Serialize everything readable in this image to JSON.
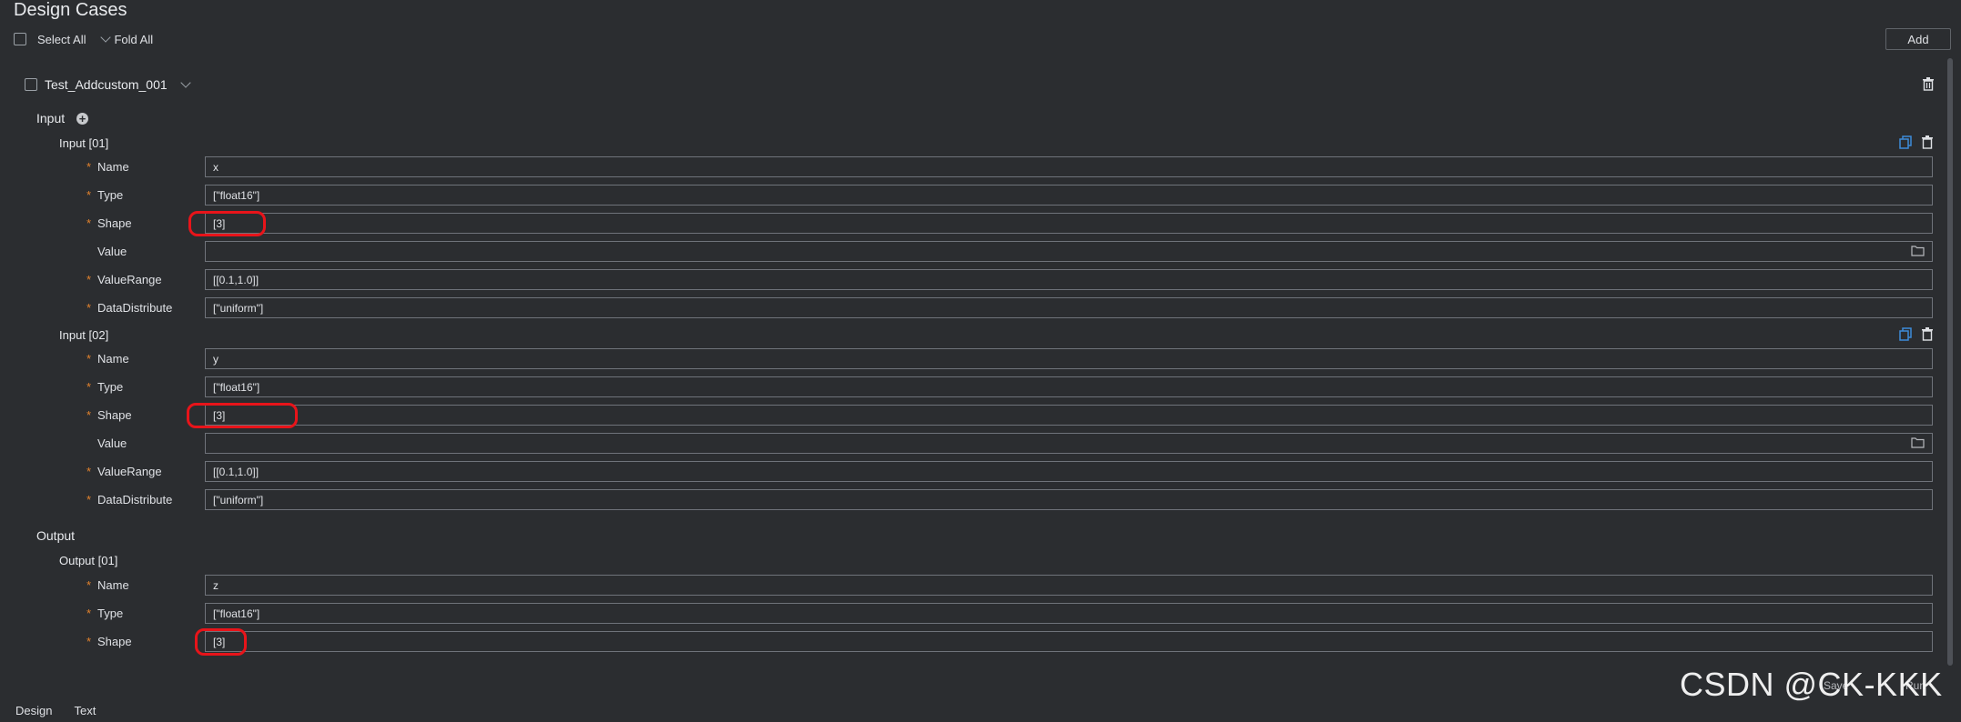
{
  "page": {
    "title": "Design Cases",
    "select_all": "Select All",
    "fold_all": "Fold All",
    "add": "Add"
  },
  "case": {
    "name": "Test_Addcustom_001"
  },
  "labels": {
    "input_section": "Input",
    "output_section": "Output",
    "required_star": "*",
    "name": "Name",
    "type": "Type",
    "shape": "Shape",
    "value": "Value",
    "value_range": "ValueRange",
    "data_distribute": "DataDistribute"
  },
  "inputs": [
    {
      "title": "Input [01]",
      "name": "x",
      "type": "[\"float16\"]",
      "shape": "[3]",
      "value": "",
      "value_range": "[[0.1,1.0]]",
      "data_distribute": "[\"uniform\"]"
    },
    {
      "title": "Input [02]",
      "name": "y",
      "type": "[\"float16\"]",
      "shape": "[3]",
      "value": "",
      "value_range": "[[0.1,1.0]]",
      "data_distribute": "[\"uniform\"]"
    }
  ],
  "outputs": [
    {
      "title": "Output [01]",
      "name": "z",
      "type": "[\"float16\"]",
      "shape": "[3]"
    }
  ],
  "footer": {
    "tabs": [
      "Design",
      "Text"
    ],
    "save": "Save",
    "run": "Run"
  },
  "watermark": "CSDN @CK-KKK",
  "icons": {
    "trash": "trash-icon",
    "copy": "copy-icon",
    "folder": "folder-icon",
    "add": "add-circle-icon",
    "chevron": "chevron-down-icon"
  },
  "colors": {
    "background": "#2b2d30",
    "required": "#e3832d",
    "highlight": "#e8141a",
    "copy_icon": "#3d8bd9"
  }
}
